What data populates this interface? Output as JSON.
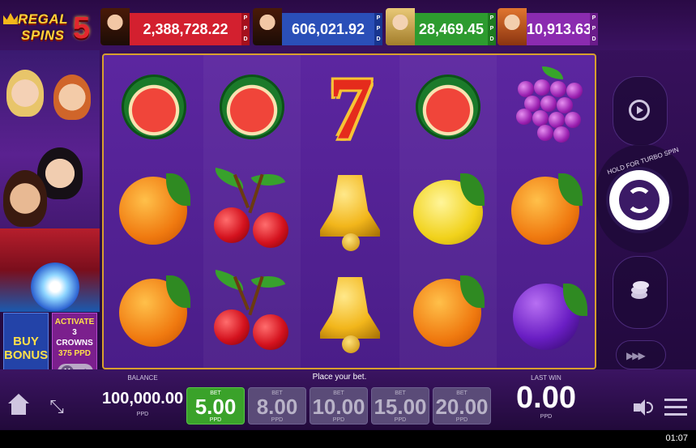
{
  "logo": {
    "line1": "REGAL",
    "line2": "SPINS",
    "number": "5"
  },
  "jackpots": [
    {
      "value": "2,388,728.22",
      "tag": "PPD",
      "color": "#d3202f"
    },
    {
      "value": "606,021.92",
      "tag": "PPD",
      "color": "#2a4fb8"
    },
    {
      "value": "28,469.45",
      "tag": "PPD",
      "color": "#2d9b2f"
    },
    {
      "value": "10,913.63",
      "tag": "PPD",
      "color": "#8b2bb0"
    }
  ],
  "buy_bonus": {
    "label1": "BUY",
    "label2": "BONUS"
  },
  "activate": {
    "line1": "ACTIVATE",
    "line2": "3",
    "line3": "CROWNS",
    "line4": "375 PPD"
  },
  "reels": [
    [
      "watermelon",
      "orange",
      "orange"
    ],
    [
      "watermelon",
      "cherry",
      "cherry"
    ],
    [
      "seven",
      "bell",
      "bell"
    ],
    [
      "watermelon",
      "lemon",
      "orange"
    ],
    [
      "grapes",
      "orange",
      "plum"
    ]
  ],
  "turbo_label": "HOLD FOR TURBO SPIN",
  "balance": {
    "label": "BALANCE",
    "value": "100,000.00",
    "currency": "PPD"
  },
  "place_bet": "Place your bet.",
  "bets": [
    {
      "label": "BET",
      "value": "5.00",
      "currency": "PPD",
      "active": true
    },
    {
      "label": "BET",
      "value": "8.00",
      "currency": "PPD",
      "active": false
    },
    {
      "label": "BET",
      "value": "10.00",
      "currency": "PPD",
      "active": false
    },
    {
      "label": "BET",
      "value": "15.00",
      "currency": "PPD",
      "active": false
    },
    {
      "label": "BET",
      "value": "20.00",
      "currency": "PPD",
      "active": false
    }
  ],
  "last_win": {
    "label": "LAST WIN",
    "value": "0.00",
    "currency": "PPD"
  },
  "clock": "01:07",
  "icons": {
    "home": "home-icon",
    "fullscreen": "fullscreen-icon",
    "sound": "speaker-icon",
    "menu": "menu-icon",
    "autoplay": "autoplay-icon",
    "spin": "spin-icon",
    "coins": "coins-icon",
    "fast": "fast-forward-icon"
  }
}
